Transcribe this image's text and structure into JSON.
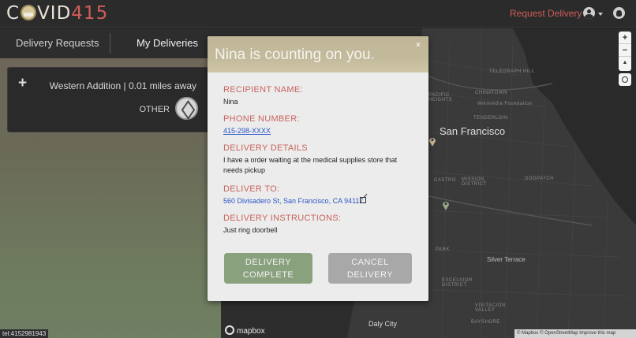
{
  "header": {
    "logo_part1": "C",
    "logo_part2": "VID",
    "logo_part3": "415",
    "request_delivery": "Request Delivery"
  },
  "sidebar": {
    "tabs": [
      {
        "label": "Delivery Requests"
      },
      {
        "label": "My Deliveries"
      }
    ],
    "card": {
      "plus": "+",
      "location": "Western Addition | 0.01 miles away",
      "category": "OTHER"
    },
    "tel_status": "tel:4152981943"
  },
  "map": {
    "city": "San Francisco",
    "city2": "Daly City",
    "area_silver": "Silver Terrace",
    "labels": [
      "TELEGRAPH HILL",
      "CHINATOWN",
      "Wikimedia Foundation",
      "TENDERLOIN",
      "PACIFIC HEIGHTS",
      "CASTRO",
      "MISSION DISTRICT",
      "DOGPATCH",
      "PARK",
      "EXCELSIOR DISTRICT",
      "VISITACION VALLEY",
      "BAYSHORE"
    ],
    "zoom_in": "+",
    "zoom_out": "−",
    "compass": "▲",
    "mapbox": "mapbox",
    "attribution": "© Mapbox © OpenStreetMap Improve this map"
  },
  "modal": {
    "title": "Nina is counting on you.",
    "close": "×",
    "recipient_label": "RECIPIENT NAME:",
    "recipient_value": "Nina",
    "phone_label": "PHONE NUMBER:",
    "phone_value": "415-298-XXXX",
    "details_label": "DELIVERY DETAILS",
    "details_value": "I have a order waiting at the medical supplies store that needs pickup",
    "deliver_to_label": "DELIVER TO:",
    "deliver_to_value": "560 Divisadero St, San Francisco, CA 94117",
    "instructions_label": "DELIVERY INSTRUCTIONS:",
    "instructions_value": "Just ring doorbell",
    "complete_line1": "DELIVERY",
    "complete_line2": "COMPLETE",
    "cancel_line1": "CANCEL",
    "cancel_line2": "DELIVERY"
  },
  "colors": {
    "accent": "#cf5d5a",
    "complete": "#8aa17e",
    "cancel": "#a8a8a8"
  }
}
